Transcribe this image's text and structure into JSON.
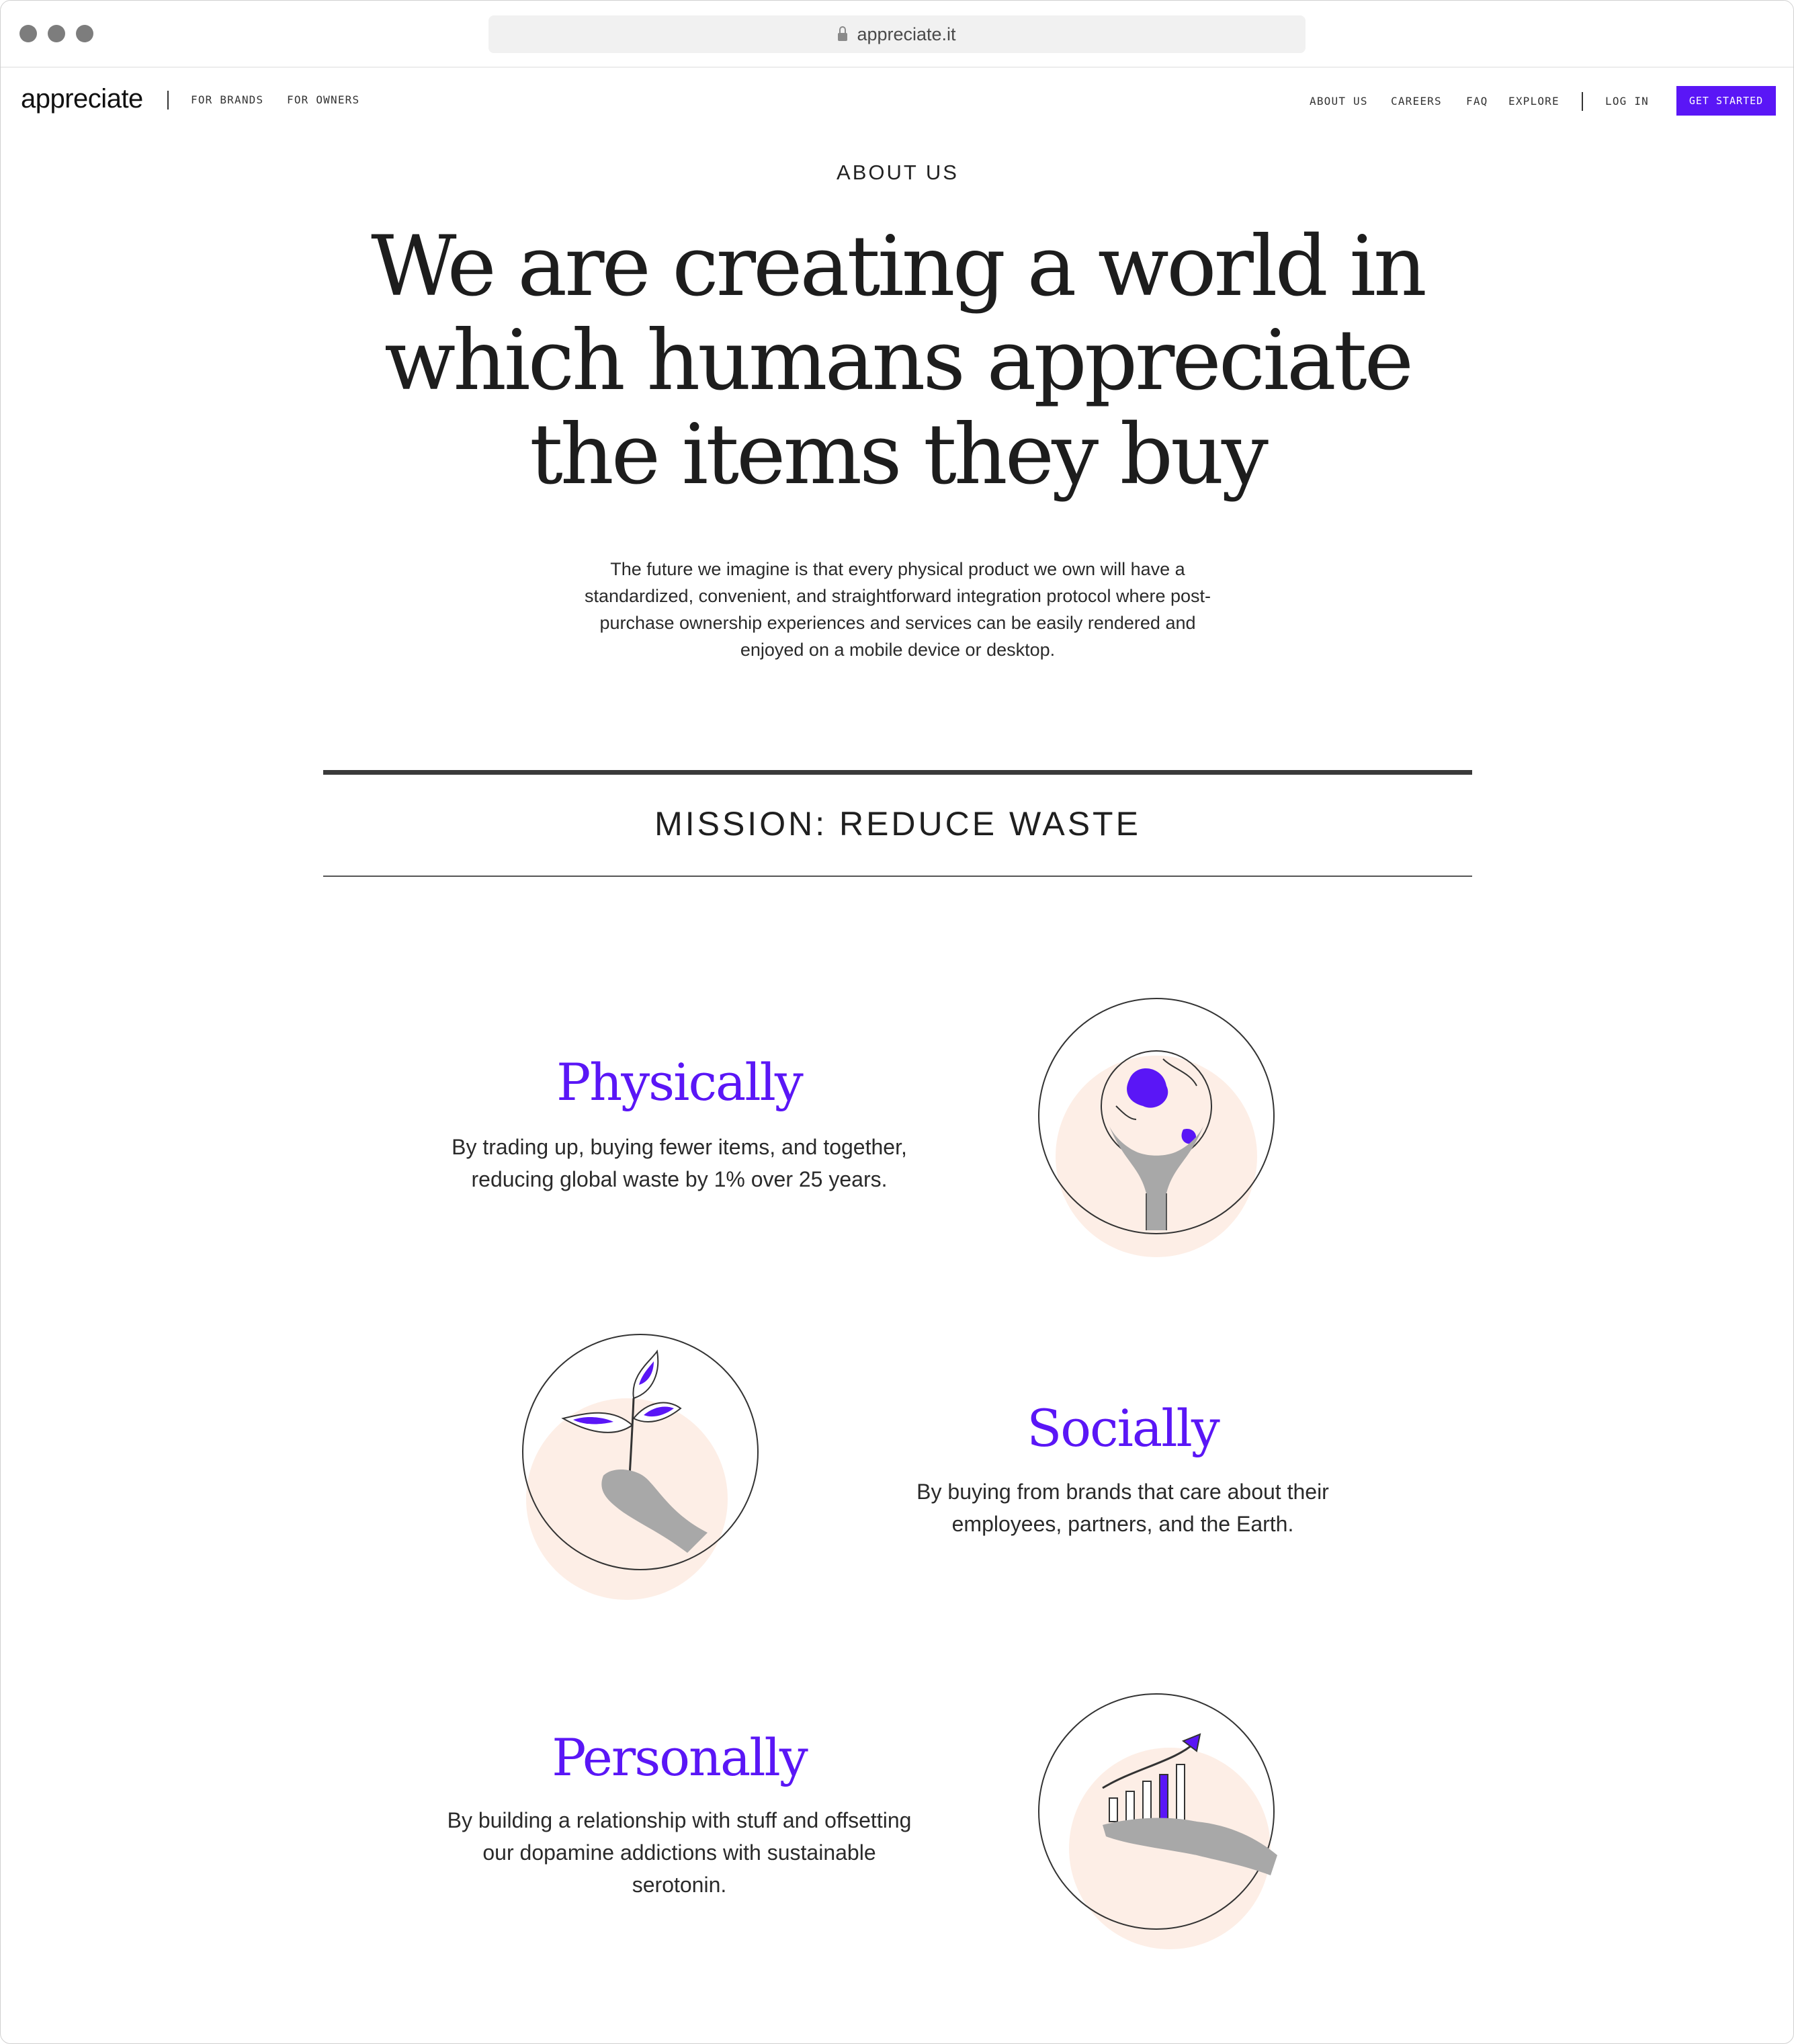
{
  "browser": {
    "url": "appreciate.it"
  },
  "nav": {
    "logo": "appreciate",
    "left_links": [
      "FOR BRANDS",
      "FOR OWNERS"
    ],
    "right_links": [
      "ABOUT US",
      "CAREERS",
      "FAQ",
      "EXPLORE"
    ],
    "login": "LOG IN",
    "cta": "GET STARTED"
  },
  "hero": {
    "eyebrow": "ABOUT US",
    "headline_lines": [
      "We are creating a world in",
      "which humans appreciate",
      "the items they buy"
    ],
    "intro_lines": [
      "The future we imagine is that every physical product we own will have a",
      "standardized, convenient, and straightforward integration protocol where post-",
      "purchase ownership experiences and services can be easily rendered and",
      "enjoyed on a mobile device or desktop."
    ]
  },
  "mission": {
    "heading": "MISSION: REDUCE WASTE",
    "items": [
      {
        "title": "Physically",
        "desc_lines": [
          "By trading up, buying fewer items, and together,",
          "reducing global waste by 1% over 25 years."
        ],
        "icon": "globe-in-hands-icon"
      },
      {
        "title": "Socially",
        "desc_lines": [
          "By buying from brands that care about their",
          "employees, partners, and the Earth."
        ],
        "icon": "sprout-in-hand-icon"
      },
      {
        "title": "Personally",
        "desc_lines": [
          "By building a relationship with stuff and offsetting",
          "our dopamine addictions with sustainable",
          "serotonin."
        ],
        "icon": "growth-chart-on-hand-icon"
      }
    ]
  },
  "colors": {
    "accent": "#5a16f6",
    "peach": "#fdeee6",
    "text": "#1f1f1f"
  }
}
